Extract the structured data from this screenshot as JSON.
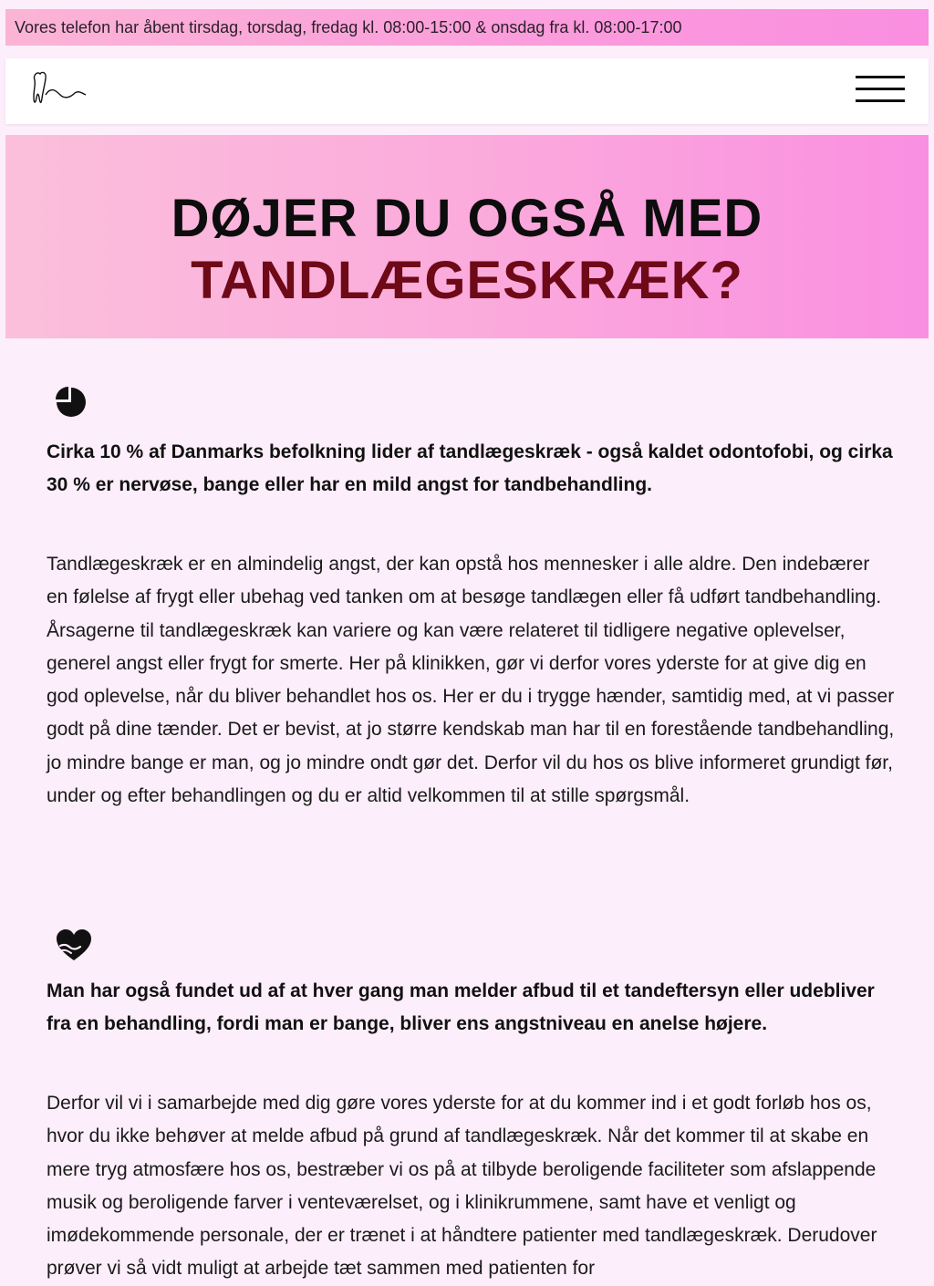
{
  "topbar": {
    "text": "Vores telefon har åbent tirsdag, torsdag, fredag kl. 08:00-15:00 & onsdag fra kl. 08:00-17:00"
  },
  "nav": {
    "logo_icon": "tooth-signature-logo",
    "menu_icon": "hamburger-menu-icon"
  },
  "hero": {
    "line1": "DØJER DU OGSÅ MED",
    "line2": "TANDLÆGESKRÆK?"
  },
  "section1": {
    "icon": "pie-chart-icon",
    "lead": "Cirka 10 % af Danmarks befolkning lider af tandlægeskræk - også kaldet odontofobi, og cirka 30 % er nervøse, bange eller har en mild angst for tandbehandling.",
    "body": "Tandlægeskræk er en almindelig angst, der kan opstå hos mennesker i alle aldre. Den indebærer en følelse af frygt eller ubehag ved tanken om at besøge tandlægen eller få udført tandbehandling. Årsagerne til tandlægeskræk kan variere og kan være relateret til tidligere negative oplevelser, generel angst eller frygt for smerte. Her på klinikken, gør vi derfor vores yderste for at give dig en god oplevelse, når du bliver behandlet hos os. Her er du i trygge hænder, samtidig med, at vi passer godt på dine tænder. Det er bevist, at jo større kendskab man har til en forestående tandbehandling, jo mindre bange er man, og jo mindre ondt gør det. Derfor vil du hos os blive informeret grundigt før, under og efter behandlingen og du er altid velkommen til at stille spørgsmål."
  },
  "section2": {
    "icon": "hand-heart-icon",
    "lead": "Man har også fundet ud af at hver gang man melder afbud til et tandeftersyn eller udebliver fra en behandling, fordi man er bange, bliver ens angstniveau en anelse højere.",
    "body": "Derfor vil vi i samarbejde med dig gøre vores yderste for at du kommer ind i et godt forløb hos os, hvor du ikke behøver at melde afbud på grund af tandlægeskræk. Når det kommer til at skabe en mere tryg atmosfære hos os, bestræber vi os på at tilbyde beroligende faciliteter som afslappende musik og beroligende farver i venteværelset, og i klinikrummene, samt have et venligt og imødekommende personale, der er trænet i at håndtere patienter med tandlægeskræk. Derudover prøver vi så vidt muligt at arbejde tæt sammen med patienten for"
  },
  "colors": {
    "accent_dark_red": "#6e0a17",
    "hero_pink_left": "#fbbfdb",
    "hero_pink_right": "#fa8fe1",
    "page_bg": "#fdeefb"
  }
}
